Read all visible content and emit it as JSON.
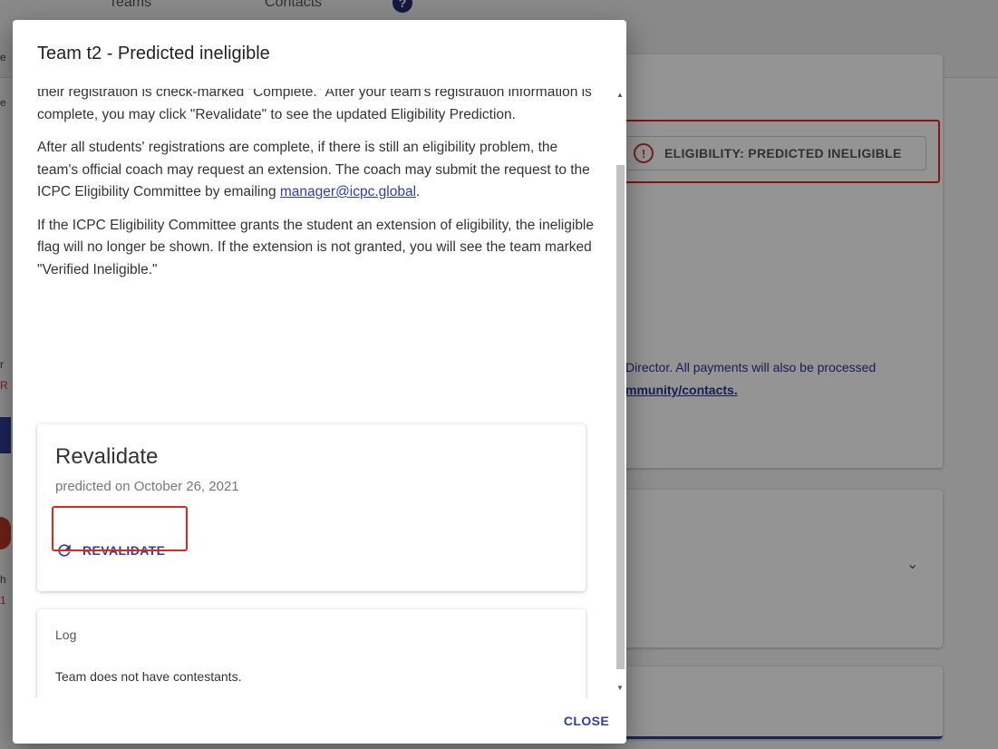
{
  "background": {
    "tabs": [
      "Teams",
      "Contacts"
    ],
    "help_icon": "?",
    "eligibility_icon": "!",
    "eligibility_label": "ELIGIBILITY: PREDICTED INELIGIBLE",
    "payment_text": "Director. All payments will also be processed",
    "contacts_link": "mmunity/contacts."
  },
  "dialog": {
    "title": "Team t2 - Predicted ineligible",
    "paragraphs": {
      "p1": "their registration is check-marked \"Complete.\" After your team's registration information is complete, you may click \"Revalidate\" to see the updated Eligibility Prediction.",
      "p2_text": "After all students' registrations are complete, if there is still an eligibility problem, the team's official coach may request an extension. The coach may submit the request to the ICPC Eligibility Committee by emailing ",
      "p2_email": "manager@icpc.global",
      "p2_end": ".",
      "p3": "If the ICPC Eligibility Committee grants the student an extension of eligibility, the ineligible flag will no longer be shown. If the extension is not granted, you will see the team marked \"Verified Ineligible.\""
    },
    "revalidate_card": {
      "title": "Revalidate",
      "subtitle": "predicted on October 26, 2021",
      "button_label": "REVALIDATE",
      "button_icon": "refresh-icon"
    },
    "log": {
      "title": "Log",
      "text": "Team does not have contestants."
    },
    "close_label": "CLOSE"
  },
  "colors": {
    "accent": "#2f3f9a",
    "highlight": "#e1261c",
    "error": "#c0392b"
  }
}
